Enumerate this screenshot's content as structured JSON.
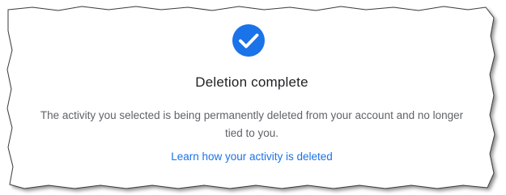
{
  "dialog": {
    "icon": "check-circle-icon",
    "title": "Deletion complete",
    "message_line1": "The activity you selected is being permanently deleted from your account and no longer",
    "message_line2": "tied to you.",
    "link_label": "Learn how your activity is deleted"
  },
  "colors": {
    "accent": "#1a73e8",
    "title": "#202124",
    "body_text": "#5f6368",
    "background": "#ffffff"
  }
}
